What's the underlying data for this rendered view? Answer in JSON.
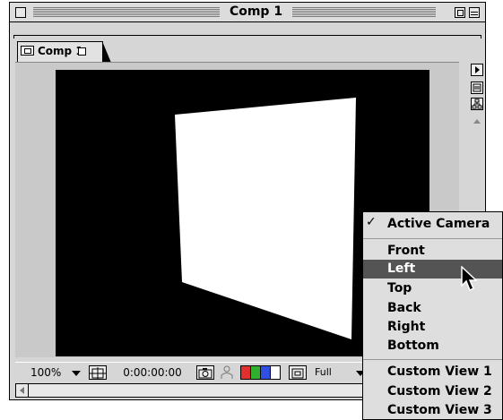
{
  "window": {
    "title": "Comp 1"
  },
  "tab": {
    "label": "Comp 1"
  },
  "statusbar": {
    "zoom": "100%",
    "timecode": "0:00:00:00",
    "resolution": "Full"
  },
  "view_menu": {
    "items": [
      {
        "label": "Active Camera",
        "checked": true
      },
      {
        "label": "Front"
      },
      {
        "label": "Left",
        "highlighted": true
      },
      {
        "label": "Top"
      },
      {
        "label": "Back"
      },
      {
        "label": "Right"
      },
      {
        "label": "Bottom"
      },
      {
        "label": "Custom View 1"
      },
      {
        "label": "Custom View 2"
      },
      {
        "label": "Custom View 3"
      }
    ],
    "check_glyph": "✓"
  },
  "colors": {
    "canvas_background": "#000000",
    "solid_layer": "#ffffff",
    "menu_highlight": "#545454",
    "channel_red": "#e03030",
    "channel_green": "#30b030",
    "channel_blue": "#3050e0",
    "channel_alpha": "#ffffff"
  },
  "icons": {
    "close_box": "close-box-icon",
    "zoom_box": "zoom-box-icon",
    "collapse_box": "collapse-box-icon",
    "comp_tab": "composition-icon",
    "fit": "fit-region-icon",
    "snapshot": "camera-snapshot-icon",
    "show_snapshot": "person-icon",
    "region": "region-of-interest-icon",
    "cursor": "arrow-cursor-icon"
  }
}
